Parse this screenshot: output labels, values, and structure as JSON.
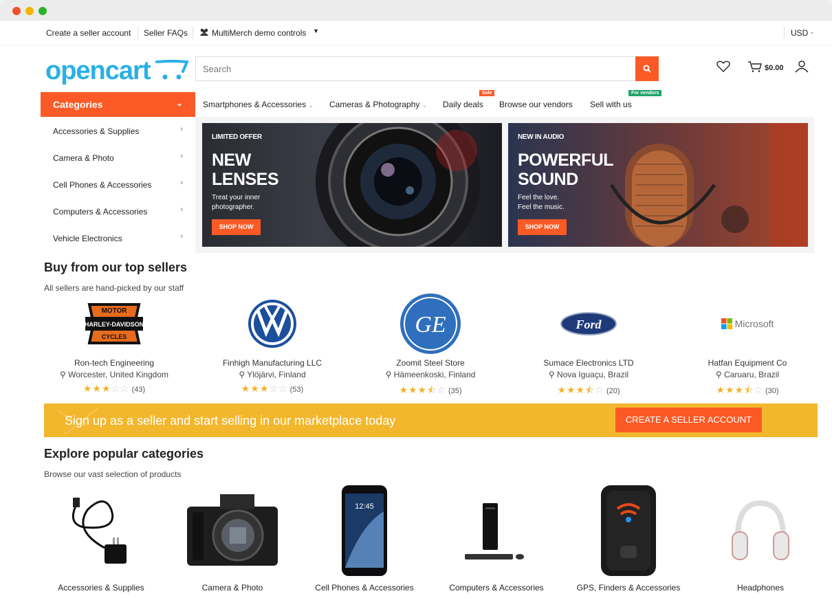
{
  "topbar": {
    "create_seller": "Create a seller account",
    "seller_faqs": "Seller FAQs",
    "demo_controls": "MultiMerch demo controls",
    "currency": "USD"
  },
  "header": {
    "logo": "opencart",
    "search_placeholder": "Search",
    "cart_total": "$0.00"
  },
  "categories": {
    "title": "Categories",
    "items": [
      "Accessories & Supplies",
      "Camera & Photo",
      "Cell Phones & Accessories",
      "Computers & Accessories",
      "Vehicle Electronics"
    ]
  },
  "nav": {
    "items": [
      "Smartphones & Accessories",
      "Cameras & Photography",
      "Daily deals",
      "Browse our vendors",
      "Sell with us"
    ],
    "badges": {
      "daily_deals": "Sale",
      "sell_with_us": "For vendors"
    }
  },
  "banners": [
    {
      "small": "LIMITED OFFER",
      "big1": "NEW",
      "big2": "LENSES",
      "sub1": "Treat your inner",
      "sub2": "photographer.",
      "cta": "SHOP NOW"
    },
    {
      "small": "NEW IN AUDIO",
      "big1": "POWERFUL",
      "big2": "SOUND",
      "sub1": "Feel the love.",
      "sub2": "Feel the music.",
      "cta": "SHOP NOW"
    }
  ],
  "top_sellers": {
    "title": "Buy from our top sellers",
    "subtitle": "All sellers are hand-picked by our staff",
    "sellers": [
      {
        "name": "Ron-tech Engineering",
        "location": "Worcester, United Kingdom",
        "rating": 3,
        "reviews": "(43)",
        "logo_text": "HARLEY-DAVIDSON",
        "logo_top": "MOTOR",
        "logo_bottom": "CYCLES"
      },
      {
        "name": "Finhigh Manufacturing LLC",
        "location": "Ylöjärvi, Finland",
        "rating": 3,
        "reviews": "(53)",
        "logo_text": "VW"
      },
      {
        "name": "Zoomit Steel Store",
        "location": "Hämeenkoski, Finland",
        "rating": 3.5,
        "reviews": "(35)",
        "logo_text": "GE"
      },
      {
        "name": "Sumace Electronics LTD",
        "location": "Nova Iguaçu, Brazil",
        "rating": 3.5,
        "reviews": "(20)",
        "logo_text": "Ford"
      },
      {
        "name": "Hatfan Equipment Co",
        "location": "Caruaru, Brazil",
        "rating": 3.5,
        "reviews": "(30)",
        "logo_text": "Microsoft"
      }
    ]
  },
  "signup": {
    "text": "Sign up as a seller and start selling in our marketplace today",
    "cta": "CREATE A SELLER ACCOUNT"
  },
  "popular": {
    "title": "Explore popular categories",
    "subtitle": "Browse our vast selection of products",
    "items": [
      "Accessories & Supplies",
      "Camera & Photo",
      "Cell Phones & Accessories",
      "Computers & Accessories",
      "GPS, Finders & Accessories",
      "Headphones"
    ]
  },
  "colors": {
    "accent": "#fb5a26",
    "logo": "#2ab0e8",
    "signup": "#f3b72d"
  }
}
